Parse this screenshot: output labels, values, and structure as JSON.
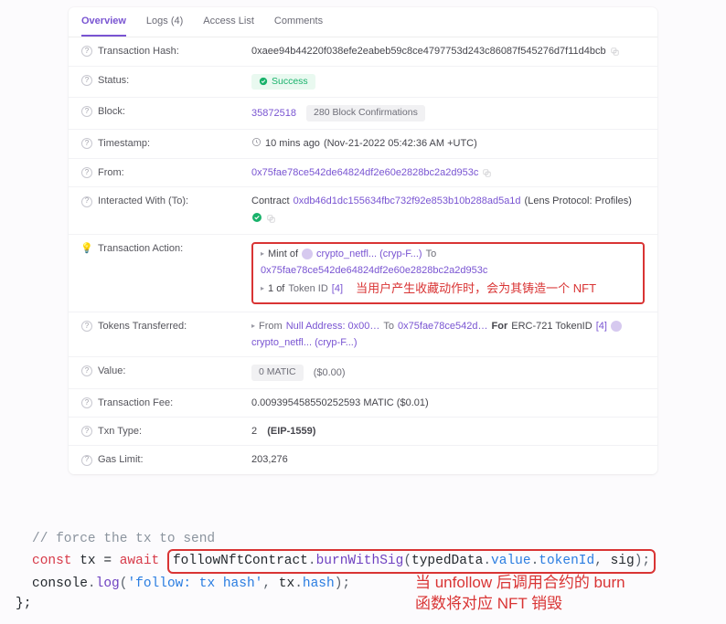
{
  "tabs": {
    "overview": "Overview",
    "logs": "Logs (4)",
    "access": "Access List",
    "comments": "Comments"
  },
  "labels": {
    "txhash": "Transaction Hash:",
    "status": "Status:",
    "block": "Block:",
    "timestamp": "Timestamp:",
    "from": "From:",
    "interacted": "Interacted With (To):",
    "action": "Transaction Action:",
    "tokens": "Tokens Transferred:",
    "value": "Value:",
    "fee": "Transaction Fee:",
    "txntype": "Txn Type:",
    "gaslimit": "Gas Limit:"
  },
  "tx": {
    "hash": "0xaee94b44220f038efe2eabeb59c8ce4797753d243c86087f545276d7f11d4bcb",
    "status": "Success",
    "block_number": "35872518",
    "block_conf": "280 Block Confirmations",
    "timestamp_rel": "10 mins ago",
    "timestamp_abs": "(Nov-21-2022 05:42:36 AM +UTC)",
    "from_addr": "0x75fae78ce542de64824df2e60e2828bc2a2d953c",
    "to_prefix": "Contract",
    "to_addr": "0xdb46d1dc155634fbc732f92e853b10b288ad5a1d",
    "to_label": "(Lens Protocol: Profiles)",
    "value_amt": "0 MATIC",
    "value_usd": "($0.00)",
    "fee": "0.009395458550252593 MATIC ($0.01)",
    "txn_type_num": "2",
    "txn_type_label": "(EIP-1559)",
    "gas_limit": "203,276"
  },
  "action": {
    "mint_prefix": "Mint of",
    "short_name": "crypto_netfl... (cryp-F...)",
    "to_word": "To",
    "mint_to": "0x75fae78ce542de64824df2e60e2828bc2a2d953c",
    "qty_prefix": "1 of",
    "token_id_label": "Token ID",
    "token_id": "[4]",
    "annotation": "当用户产生收藏动作时，会为其铸造一个 NFT"
  },
  "transfer": {
    "from_word": "From",
    "from_addr": "Null Address: 0x00…",
    "to_word": "To",
    "to_addr": "0x75fae78ce542d…",
    "for_word": "For",
    "erc": "ERC-721 TokenID",
    "token_id": "[4]",
    "token_name": "crypto_netfl... (cryp-F...)"
  },
  "code": {
    "comment": "// force the tx to send",
    "kw_const": "const",
    "tx_var": "tx",
    "eq": " = ",
    "kw_await": "await",
    "contract": "followNftContract",
    "method": "burnWithSig",
    "arg1a": "typedData",
    "arg1b": "value",
    "arg1c": "tokenId",
    "arg2": "sig",
    "log_obj": "console",
    "log_fn": "log",
    "log_str": "'follow: tx hash'",
    "log_arg": "tx",
    "log_prop": "hash",
    "closer": "};",
    "annotation_l1": "当 unfollow 后调用合约的 burn",
    "annotation_l2": "函数将对应 NFT 销毁"
  }
}
